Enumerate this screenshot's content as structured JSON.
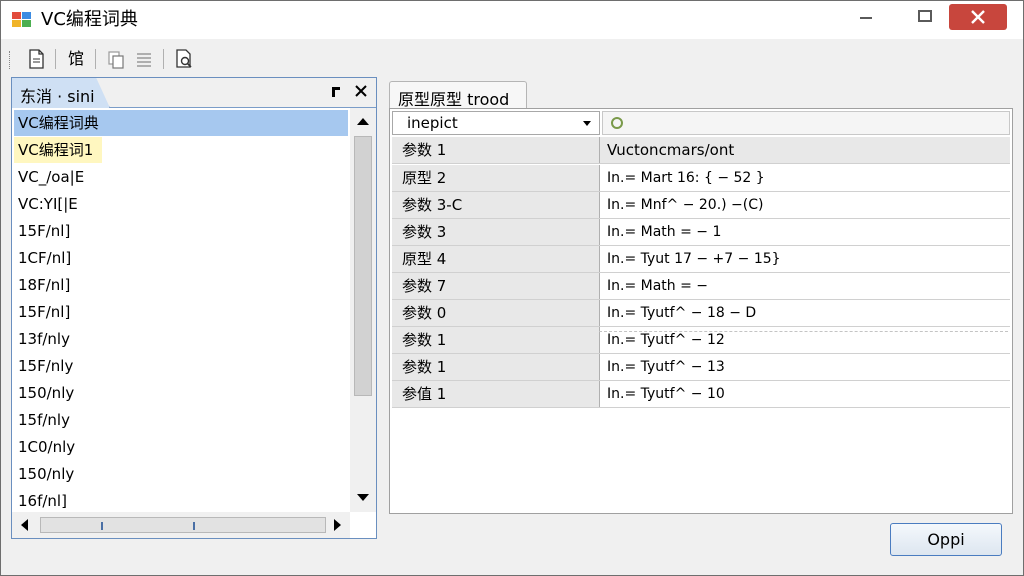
{
  "window": {
    "title": "VC编程词典",
    "colors": {
      "close": "#c8463d",
      "selection": "#a6c8ef",
      "pane_border": "#6a8fbf"
    }
  },
  "toolbar": {
    "buttons": [
      {
        "icon": "new-document-icon"
      },
      {
        "icon": "index-icon",
        "label": "馆"
      },
      {
        "icon": "copy-icon"
      },
      {
        "icon": "list-icon"
      },
      {
        "icon": "search-document-icon"
      }
    ]
  },
  "left_pane": {
    "tab_label": "东消 · sini",
    "items": [
      "VC编程词典",
      "VC编程词1",
      "VC_/oa|E",
      "VC:YI[|E",
      "15F/nl]",
      "1CF/nl]",
      "18F/nl]",
      "15F/nl]",
      "13f/nly",
      "15F/nly",
      "150/nly",
      "15f/nly",
      "1C0/nly",
      "150/nly",
      "16f/nl]"
    ]
  },
  "right_pane": {
    "tab_label": "原型原型 trood",
    "combo_value": "inepict",
    "header": {
      "name": "参数 1",
      "value": "Vuctoncmars/ont"
    },
    "rows": [
      {
        "name": "原型 2",
        "value": "In.= Mart 16: { − 52 }"
      },
      {
        "name": "参数 3-C",
        "value": "In.= Mnf^ − 20.) −(C)"
      },
      {
        "name": "参数 3",
        "value": "In.= Math = − 1"
      },
      {
        "name": "原型 4",
        "value": "In.= Tyut 17 − +7 − 15}"
      },
      {
        "name": "参数 7",
        "value": "In.= Math = −"
      },
      {
        "name": "参数 0",
        "value": "In.= Tyutf^ − 18 − D"
      },
      {
        "name": "参数 1",
        "value": "In.= Tyutf^ − 12"
      },
      {
        "name": "参数 1",
        "value": "In.= Tyutf^ − 13"
      },
      {
        "name": "参值 1",
        "value": "In.= Tyutf^ − 10"
      }
    ]
  },
  "footer": {
    "ok_label": "Oppi"
  }
}
